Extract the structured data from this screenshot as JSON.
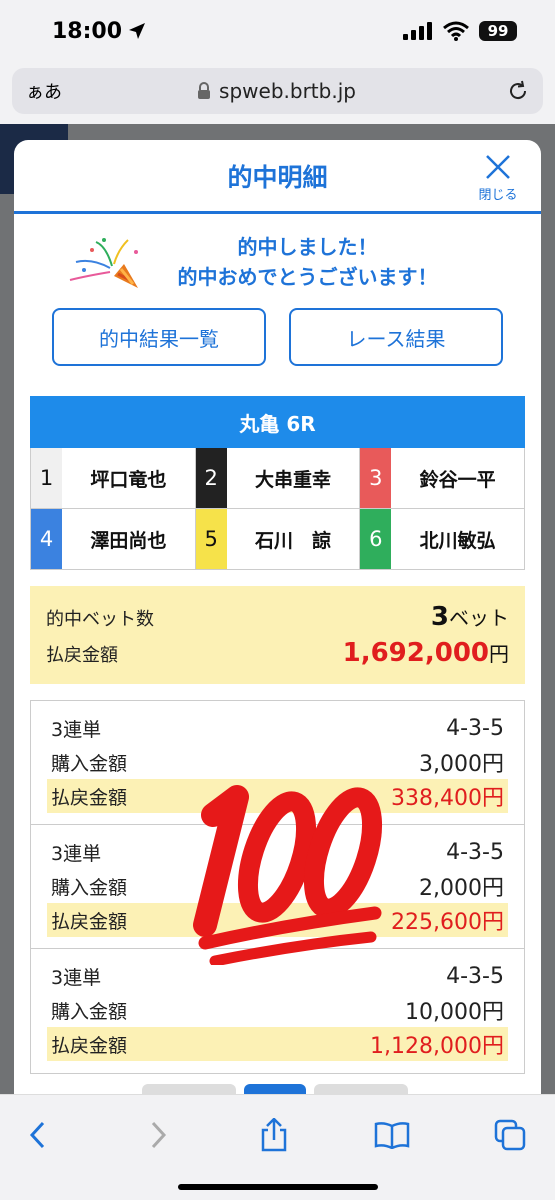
{
  "status": {
    "time": "18:00",
    "battery": "99"
  },
  "browser": {
    "aa": "ぁあ",
    "url": "spweb.brtb.jp"
  },
  "modal": {
    "title": "的中明細",
    "close_label": "閉じる",
    "congrats_line1": "的中しました！",
    "congrats_line2": "的中おめでとうございます！",
    "btn_results_list": "的中結果一覧",
    "btn_race_results": "レース結果"
  },
  "race": {
    "title": "丸亀 6R",
    "racers": [
      {
        "lane": "1",
        "name": "坪口竜也",
        "bg": "#f0f0f0",
        "fg": "#111111"
      },
      {
        "lane": "2",
        "name": "大串重幸",
        "bg": "#222222",
        "fg": "#ffffff"
      },
      {
        "lane": "3",
        "name": "鈴谷一平",
        "bg": "#e85a5a",
        "fg": "#ffffff"
      },
      {
        "lane": "4",
        "name": "澤田尚也",
        "bg": "#3b82e0",
        "fg": "#ffffff"
      },
      {
        "lane": "5",
        "name": "石川　諒",
        "bg": "#f6e24a",
        "fg": "#111111"
      },
      {
        "lane": "6",
        "name": "北川敏弘",
        "bg": "#2fae5c",
        "fg": "#ffffff"
      }
    ]
  },
  "summary": {
    "bets_label": "的中ベット数",
    "bets_count": "3",
    "bets_unit": "ベット",
    "payout_label": "払戻金額",
    "payout_amount": "1,692,000",
    "payout_unit": "円"
  },
  "tickets": [
    {
      "type": "3連単",
      "combo": "4-3-5",
      "purchase_label": "購入金額",
      "purchase": "3,000円",
      "payout_label": "払戻金額",
      "payout": "338,400円"
    },
    {
      "type": "3連単",
      "combo": "4-3-5",
      "purchase_label": "購入金額",
      "purchase": "2,000円",
      "payout_label": "払戻金額",
      "payout": "225,600円"
    },
    {
      "type": "3連単",
      "combo": "4-3-5",
      "purchase_label": "購入金額",
      "purchase": "10,000円",
      "payout_label": "払戻金額",
      "payout": "1,128,000円"
    }
  ],
  "colors": {
    "accent": "#1e73d8",
    "highlight": "#fcf1b5",
    "money_red": "#e01e1e"
  },
  "icons": [
    "location-arrow-icon",
    "signal-icon",
    "wifi-icon",
    "lock-icon",
    "reload-icon",
    "close-icon",
    "party-popper-icon",
    "hundred-points-icon",
    "back-icon",
    "forward-icon",
    "share-icon",
    "bookmarks-icon",
    "tabs-icon"
  ]
}
